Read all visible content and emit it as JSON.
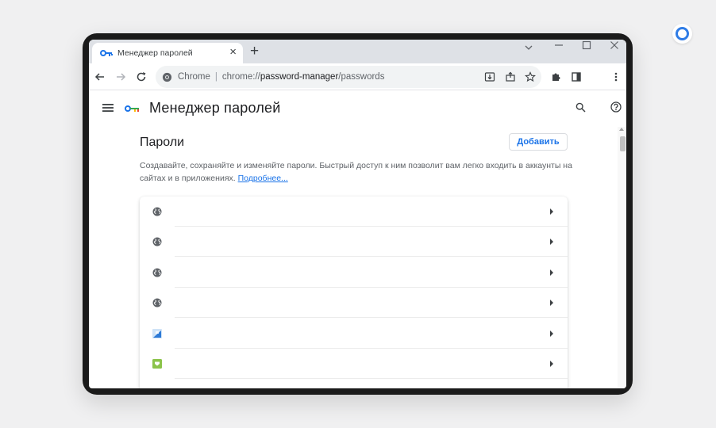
{
  "browser": {
    "tab_title": "Менеджер паролей",
    "tab_close": "×",
    "new_tab": "+",
    "omnibox": {
      "site_label": "Chrome",
      "url_scheme": "chrome://",
      "url_host": "password-manager",
      "url_path": "/passwords"
    }
  },
  "window_controls": {
    "tab_search": "⌵",
    "minimize": "—",
    "maximize": "☐",
    "close": "✕"
  },
  "header": {
    "title": "Менеджер паролей"
  },
  "passwords": {
    "section_title": "Пароли",
    "add_label": "Добавить",
    "description": "Создавайте, сохраняйте и изменяйте пароли. Быстрый доступ к ним позволит вам легко входить в аккаунты на сайтах и в приложениях.",
    "learn_more": "Подробнее...",
    "items": [
      {
        "icon": "globe-icon"
      },
      {
        "icon": "globe-icon"
      },
      {
        "icon": "globe-icon"
      },
      {
        "icon": "globe-icon"
      },
      {
        "icon": "site-favicon-blue"
      },
      {
        "icon": "site-favicon-green"
      }
    ]
  },
  "colors": {
    "accent": "#1a73e8",
    "ring": "#2f7ce6",
    "favicon_green": "#8bc34a"
  }
}
